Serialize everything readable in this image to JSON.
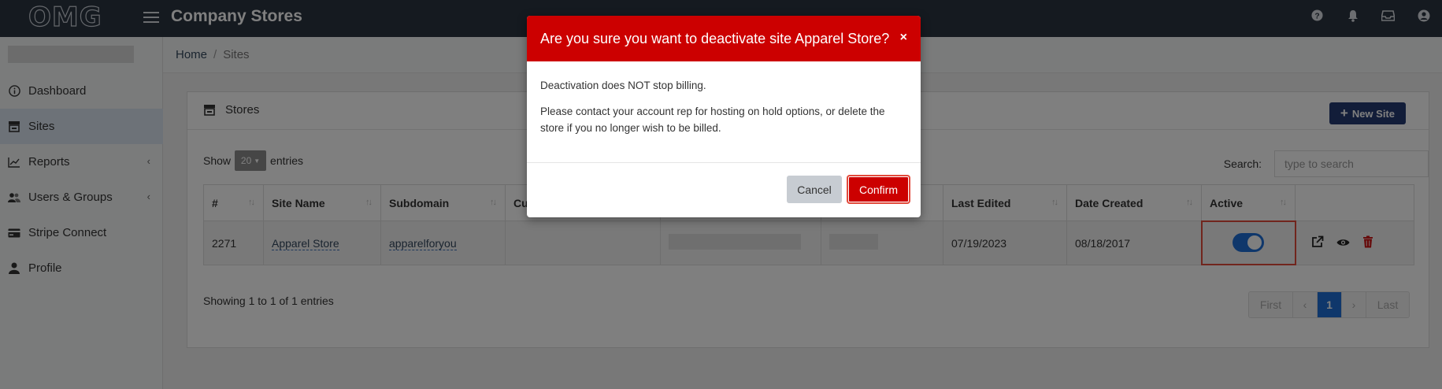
{
  "topbar": {
    "logo": "OMG",
    "title": "Company Stores",
    "icons": [
      "help-icon",
      "bell-icon",
      "inbox-icon",
      "user-icon"
    ]
  },
  "sidebar": {
    "items": [
      {
        "label": "Dashboard",
        "icon": "info-icon",
        "chevron": false
      },
      {
        "label": "Sites",
        "icon": "store-icon",
        "chevron": false,
        "active": true
      },
      {
        "label": "Reports",
        "icon": "chart-icon",
        "chevron": true
      },
      {
        "label": "Users & Groups",
        "icon": "users-icon",
        "chevron": true
      },
      {
        "label": "Stripe Connect",
        "icon": "card-icon",
        "chevron": false
      },
      {
        "label": "Profile",
        "icon": "user-icon",
        "chevron": false
      }
    ]
  },
  "breadcrumb": {
    "home": "Home",
    "separator": "/",
    "current": "Sites"
  },
  "card": {
    "title": "Stores",
    "new_site_label": "New Site",
    "show_label": "Show",
    "entries_label": "entries",
    "page_length": "20",
    "search_label": "Search:",
    "search_placeholder": "type to search"
  },
  "table": {
    "headers": [
      "#",
      "Site Name",
      "Subdomain",
      "Cu",
      "",
      "",
      "Last Edited",
      "Date Created",
      "Active",
      ""
    ],
    "rows": [
      {
        "id": "2271",
        "site_name": "Apparel Store",
        "subdomain": "apparelforyou",
        "last_edited": "07/19/2023",
        "date_created": "08/18/2017",
        "active": true
      }
    ]
  },
  "footer": {
    "info": "Showing 1 to 1 of 1 entries",
    "pager": {
      "first": "First",
      "prev": "‹",
      "page": "1",
      "next": "›",
      "last": "Last"
    }
  },
  "modal": {
    "title": "Are you sure you want to deactivate site Apparel Store?",
    "close": "×",
    "line1": "Deactivation does NOT stop billing.",
    "line2": "Please contact your account rep for hosting on hold options, or delete the store if you no longer wish to be billed.",
    "cancel_label": "Cancel",
    "confirm_label": "Confirm"
  },
  "colors": {
    "primary_red": "#cc0000",
    "navy": "#243a73",
    "toggle_blue": "#1f6fd6",
    "topbar": "#2b3440"
  }
}
